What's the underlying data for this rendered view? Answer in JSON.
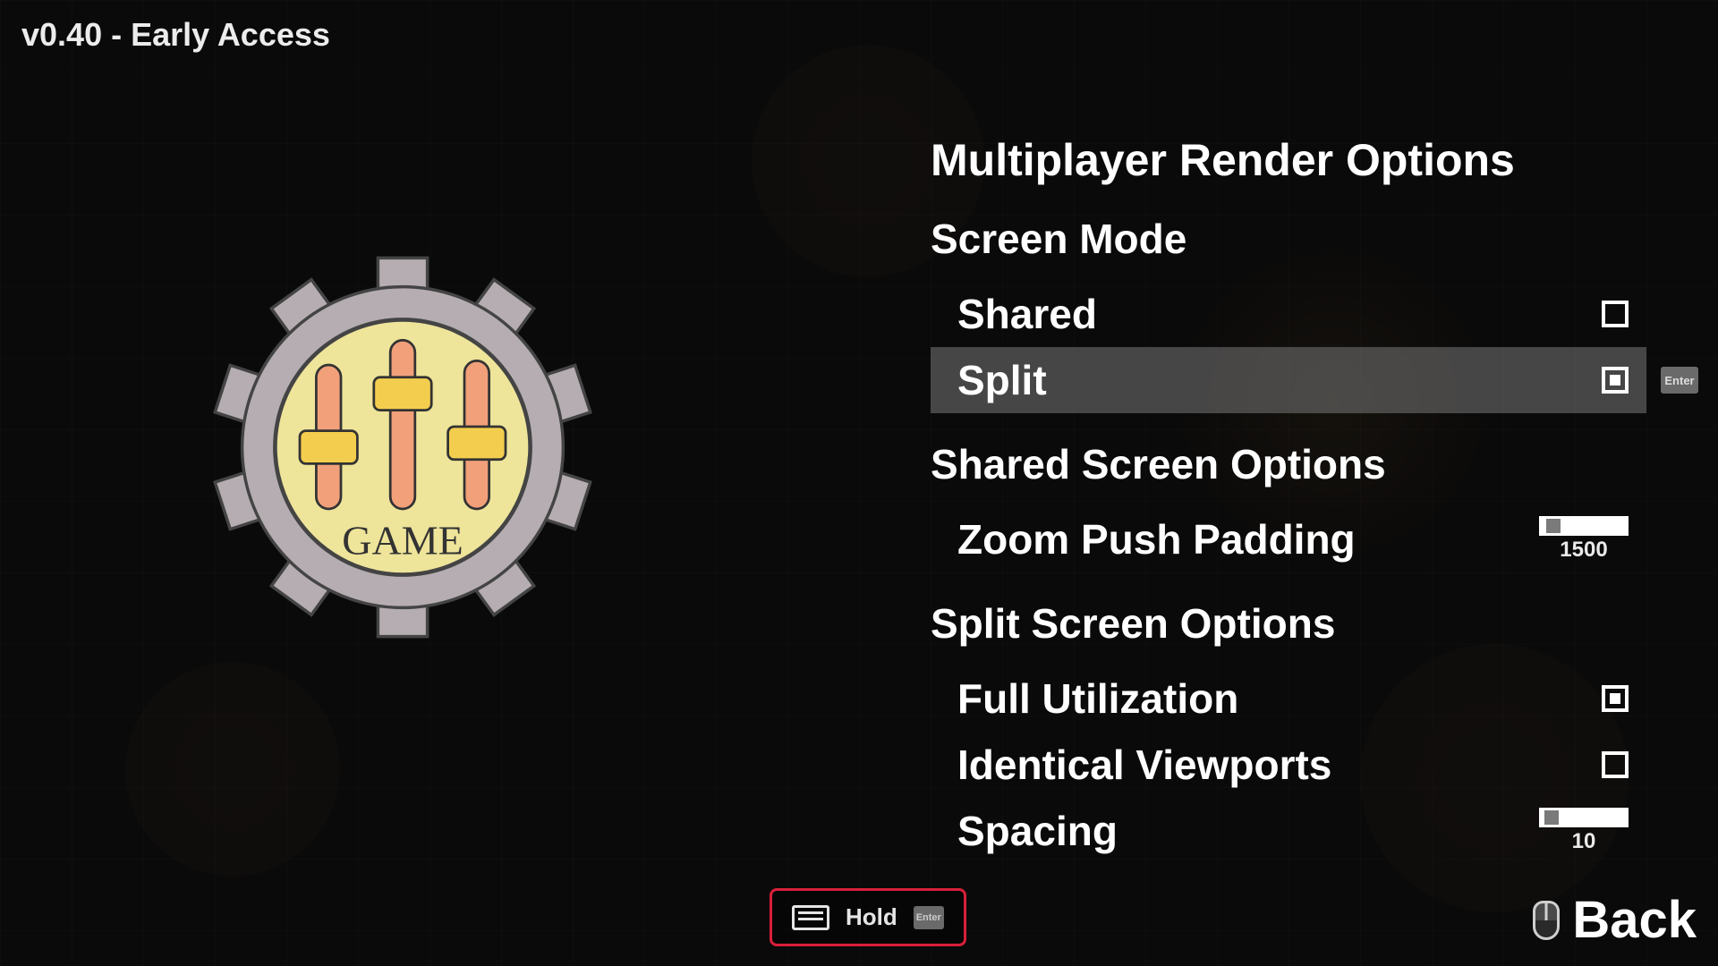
{
  "version_label": "v0.40 - Early Access",
  "gear": {
    "caption": "GAME"
  },
  "panel": {
    "title": "Multiplayer Render Options",
    "sections": [
      {
        "heading": "Screen Mode",
        "items": [
          {
            "label": "Shared",
            "type": "radio",
            "checked": false,
            "selected": false
          },
          {
            "label": "Split",
            "type": "radio",
            "checked": true,
            "selected": true
          }
        ]
      },
      {
        "heading": "Shared Screen Options",
        "items": [
          {
            "label": "Zoom Push Padding",
            "type": "slider",
            "value": 1500,
            "frac": 0.12
          }
        ]
      },
      {
        "heading": "Split Screen Options",
        "items": [
          {
            "label": "Full Utilization",
            "type": "checkbox",
            "checked": true
          },
          {
            "label": "Identical Viewports",
            "type": "checkbox",
            "checked": false
          },
          {
            "label": "Spacing",
            "type": "slider",
            "value": 10,
            "frac": 0.1
          }
        ]
      }
    ]
  },
  "hints": {
    "enter_key": "Enter",
    "hold_label": "Hold",
    "enter_key_small": "Enter"
  },
  "back_label": "Back"
}
